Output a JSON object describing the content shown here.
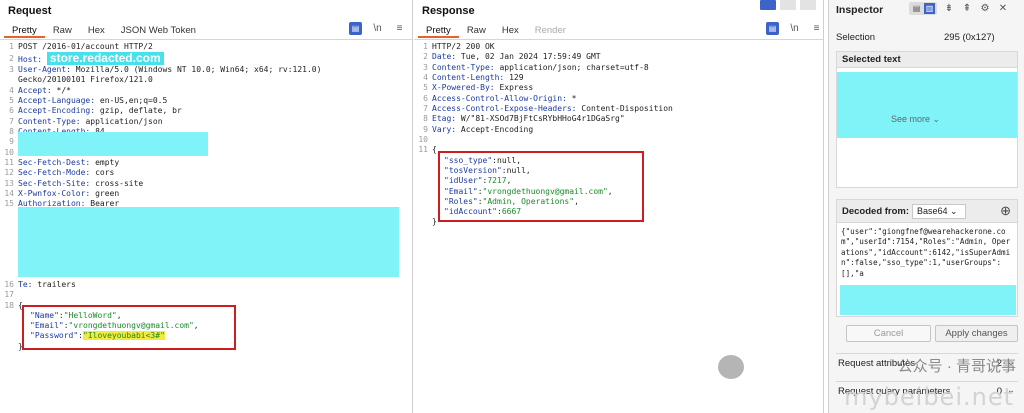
{
  "request": {
    "title": "Request",
    "tabs": [
      "Pretty",
      "Raw",
      "Hex",
      "JSON Web Token"
    ],
    "tool_newline": "\\n",
    "tool_menu": "≡",
    "lines": {
      "l1": {
        "num": "1",
        "text": "POST /2016-01/account HTTP/2"
      },
      "l2": {
        "num": "2",
        "key": "Host:",
        "host": "store.redacted.com"
      },
      "l3": {
        "num": "3",
        "key": "User-Agent:",
        "value": " Mozilla/5.0 (Windows NT 10.0; Win64; x64; rv:121.0)"
      },
      "l3b": {
        "text": "Gecko/20100101 Firefox/121.0"
      },
      "l4": {
        "num": "4",
        "key": "Accept:",
        "value": " */*"
      },
      "l5": {
        "num": "5",
        "key": "Accept-Language:",
        "value": " en-US,en;q=0.5"
      },
      "l6": {
        "num": "6",
        "key": "Accept-Encoding:",
        "value": " gzip, deflate, br"
      },
      "l7": {
        "num": "7",
        "key": "Content-Type:",
        "value": " application/json"
      },
      "l8": {
        "num": "8",
        "key": "Content-Length:",
        "value": " 84"
      },
      "l9": {
        "num": "9"
      },
      "l10": {
        "num": "10"
      },
      "l11": {
        "num": "11",
        "key": "Sec-Fetch-Dest:",
        "value": " empty"
      },
      "l12": {
        "num": "12",
        "key": "Sec-Fetch-Mode:",
        "value": " cors"
      },
      "l13": {
        "num": "13",
        "key": "Sec-Fetch-Site:",
        "value": " cross-site"
      },
      "l14": {
        "num": "14",
        "key": "X-Pwnfox-Color:",
        "value": " green"
      },
      "l15": {
        "num": "15",
        "key": "Authorization:",
        "value": " Bearer"
      },
      "l16": {
        "num": "16",
        "key": "Te:",
        "value": " trailers"
      },
      "l17": {
        "num": "17"
      },
      "l18": {
        "num": "18",
        "text": "{"
      },
      "j1": {
        "key": "\"Name\"",
        "value": "\"HelloWord\"",
        "tail": ","
      },
      "j2": {
        "key": "\"Email\"",
        "value": "\"vrongdethuongv@gmail.com\"",
        "tail": ","
      },
      "j3": {
        "key": "\"Password\"",
        "value": "\"Iloveyoubabi<3#\""
      },
      "jclose": {
        "text": "}"
      }
    }
  },
  "response": {
    "title": "Response",
    "tabs": [
      "Pretty",
      "Raw",
      "Hex",
      "Render"
    ],
    "tool_newline": "\\n",
    "tool_menu": "≡",
    "lines": {
      "l1": {
        "num": "1",
        "text": "HTTP/2 200 OK"
      },
      "l2": {
        "num": "2",
        "key": "Date:",
        "value": " Tue, 02 Jan 2024 17:59:49 GMT"
      },
      "l3": {
        "num": "3",
        "key": "Content-Type:",
        "value": " application/json; charset=utf-8"
      },
      "l4": {
        "num": "4",
        "key": "Content-Length:",
        "value": " 129"
      },
      "l5": {
        "num": "5",
        "key": "X-Powered-By:",
        "value": " Express"
      },
      "l6": {
        "num": "6",
        "key": "Access-Control-Allow-Origin:",
        "value": " *"
      },
      "l7": {
        "num": "7",
        "key": "Access-Control-Expose-Headers:",
        "value": " Content-Disposition"
      },
      "l8": {
        "num": "8",
        "key": "Etag:",
        "value": " W/\"81-XSOd7BjFtCsRYbHHoG4r1DGaSrg\""
      },
      "l9": {
        "num": "9",
        "key": "Vary:",
        "value": " Accept-Encoding"
      },
      "l10": {
        "num": "10"
      },
      "l11": {
        "num": "11",
        "text": "{"
      },
      "j1": {
        "key": "\"sso_type\"",
        "value": "null",
        "tail": ","
      },
      "j2": {
        "key": "\"tosVersion\"",
        "value": "null",
        "tail": ","
      },
      "j3": {
        "key": "\"idUser\"",
        "value": "7217",
        "tail": ","
      },
      "j4": {
        "key": "\"Email\"",
        "value": "\"vrongdethuongv@gmail.com\"",
        "tail": ","
      },
      "j5": {
        "key": "\"Roles\"",
        "value": "\"Admin, Operations\"",
        "tail": ","
      },
      "j6": {
        "key": "\"idAccount\"",
        "value": "6667"
      },
      "jclose": {
        "text": "}"
      }
    }
  },
  "inspector": {
    "title": "Inspector",
    "selection_label": "Selection",
    "selection_value": "295 (0x127)",
    "selected_text_label": "Selected text",
    "see_more": "See more",
    "decoded_from_label": "Decoded from:",
    "decoder": "Base64",
    "decoded_text": "{\"user\":\"giongfnef@wearehackerone.com\",\"userId\":7154,\"Roles\":\"Admin, Operations\",\"idAccount\":6142,\"isSuperAdmin\":false,\"sso_type\":1,\"userGroups\":[],\"a",
    "cancel_label": "Cancel",
    "apply_label": "Apply changes",
    "attributes_label": "Request attributes",
    "attributes_count": "2",
    "query_label": "Request query parameters",
    "query_count": "0"
  },
  "watermark": {
    "text": "公众号 · 青哥说事",
    "site": "mybeibei.net"
  },
  "colors": {
    "accent": "#e8632b",
    "highlight_box": "#cc1e1e",
    "redaction": "#7ff3f7",
    "header_key": "#1d3a9e",
    "json_string": "#1b8a2b"
  }
}
